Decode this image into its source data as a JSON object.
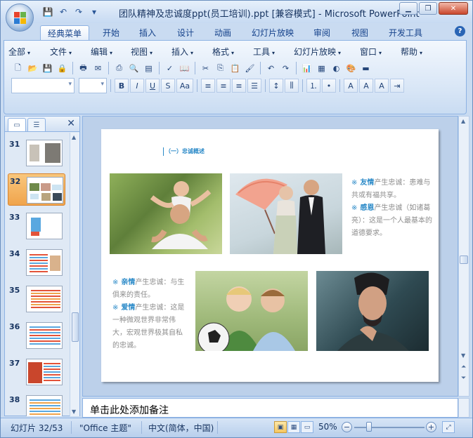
{
  "window": {
    "title": "团队精神及忠诚度ppt(员工培训).ppt [兼容模式] - Microsoft PowerPoint",
    "controls": [
      "minimize",
      "restore",
      "close"
    ]
  },
  "quick_access": [
    "save-icon",
    "undo-icon",
    "redo-icon",
    "customize-icon"
  ],
  "ribbon_tabs": [
    {
      "label": "经典菜单",
      "active": true
    },
    {
      "label": "开始"
    },
    {
      "label": "插入"
    },
    {
      "label": "设计"
    },
    {
      "label": "动画"
    },
    {
      "label": "幻灯片放映"
    },
    {
      "label": "审阅"
    },
    {
      "label": "视图"
    },
    {
      "label": "开发工具"
    }
  ],
  "menus": [
    "全部",
    "文件",
    "编辑",
    "视图",
    "插入",
    "格式",
    "工具",
    "幻灯片放映",
    "窗口",
    "帮助"
  ],
  "format_buttons": [
    "B",
    "I",
    "U",
    "S",
    "Aa"
  ],
  "slide_panel": {
    "slides": [
      {
        "number": "31"
      },
      {
        "number": "32",
        "selected": true
      },
      {
        "number": "33"
      },
      {
        "number": "34"
      },
      {
        "number": "35"
      },
      {
        "number": "36"
      },
      {
        "number": "37"
      },
      {
        "number": "38"
      }
    ]
  },
  "slide": {
    "title": "（一）忠诚概述",
    "blocks": [
      {
        "marker": "※",
        "key": "友情",
        "text": "产生忠诚：患难与共或有福共享。"
      },
      {
        "marker": "※",
        "key": "感恩",
        "text": "产生忠诚（如诸葛亮）：这是一个人最基本的道德要求。"
      },
      {
        "marker": "※",
        "key": "亲情",
        "text": "产生忠诚：与生俱来的责任。"
      },
      {
        "marker": "※",
        "key": "爱情",
        "text": "产生忠诚：这是一种微观世界非常伟大，宏观世界极其自私的忠诚。"
      }
    ]
  },
  "notes": {
    "placeholder": "单击此处添加备注"
  },
  "status": {
    "slide_count": "幻灯片 32/53",
    "theme": "\"Office 主题\"",
    "language": "中文(简体，中国)",
    "zoom": "50%",
    "zoom_fraction": 0.5
  },
  "colors": {
    "accent": "#2b8ac8",
    "body_text": "#8c8c8c",
    "selected_thumb": "#f0a44c"
  }
}
